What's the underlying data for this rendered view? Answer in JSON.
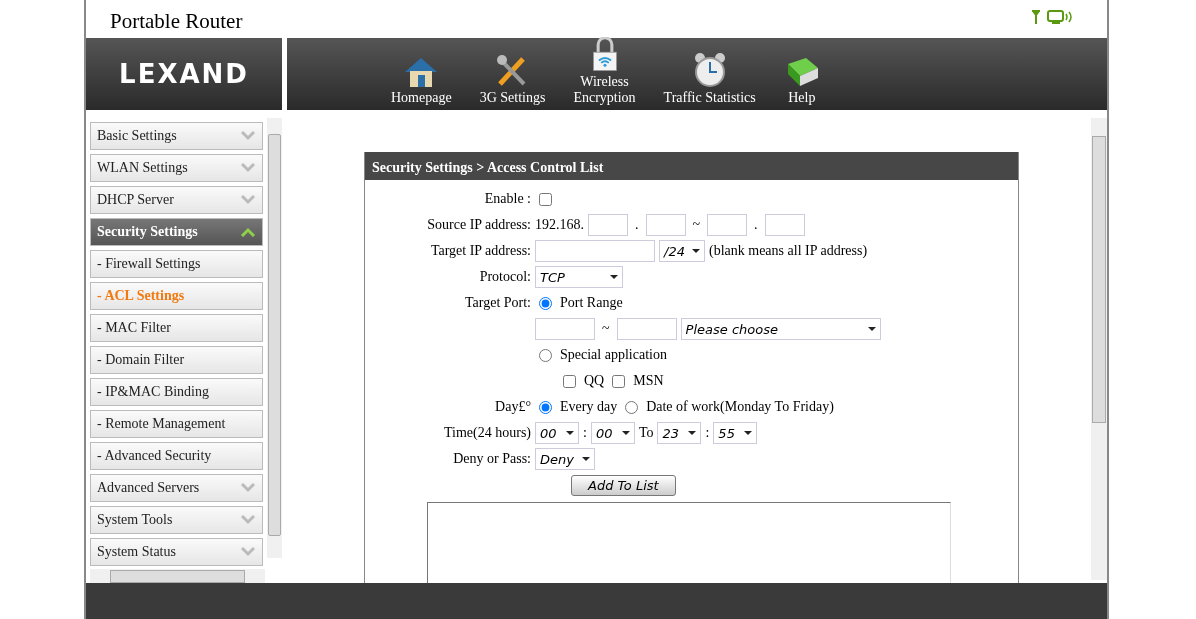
{
  "window": {
    "title": "Portable Router"
  },
  "logo": {
    "text": "LEXAND"
  },
  "nav": [
    {
      "label": "Homepage"
    },
    {
      "label": "3G Settings"
    },
    {
      "label": "Wireless\nEncryption"
    },
    {
      "label": "Traffic Statistics"
    },
    {
      "label": "Help"
    }
  ],
  "sidebar": {
    "items": [
      {
        "label": "Basic Settings",
        "kind": "group",
        "expanded": false,
        "selected": false
      },
      {
        "label": "WLAN Settings",
        "kind": "group",
        "expanded": false,
        "selected": false
      },
      {
        "label": "DHCP Server",
        "kind": "group",
        "expanded": false,
        "selected": false
      },
      {
        "label": "Security Settings",
        "kind": "group",
        "expanded": true,
        "selected": false
      },
      {
        "label": "- Firewall Settings",
        "kind": "sub",
        "selected": false
      },
      {
        "label": "- ACL Settings",
        "kind": "sub",
        "selected": true
      },
      {
        "label": "- MAC Filter",
        "kind": "sub",
        "selected": false
      },
      {
        "label": "- Domain Filter",
        "kind": "sub",
        "selected": false
      },
      {
        "label": "- IP&MAC Binding",
        "kind": "sub",
        "selected": false
      },
      {
        "label": "- Remote Management",
        "kind": "sub",
        "selected": false
      },
      {
        "label": "- Advanced Security",
        "kind": "sub",
        "selected": false
      },
      {
        "label": "Advanced Servers",
        "kind": "group",
        "expanded": false,
        "selected": false
      },
      {
        "label": "System Tools",
        "kind": "group",
        "expanded": false,
        "selected": false
      },
      {
        "label": "System Status",
        "kind": "group",
        "expanded": false,
        "selected": false
      }
    ]
  },
  "panel": {
    "title": "Security Settings > Access Control List",
    "enable": {
      "label": "Enable :",
      "checked": false
    },
    "source_ip": {
      "label": "Source IP address:",
      "prefix": "192.168.",
      "dot": ".",
      "tilde": "~"
    },
    "target_ip": {
      "label": "Target IP address:",
      "mask": "/24",
      "hint": "(blank means all IP address)"
    },
    "protocol": {
      "label": "Protocol:",
      "value": "TCP"
    },
    "target_port": {
      "label": "Target Port:",
      "options": [
        {
          "label": "Port Range",
          "selected": true
        },
        {
          "label": "Special application",
          "selected": false
        }
      ],
      "tilde": "~",
      "service": "Please choose",
      "apps": [
        {
          "label": "QQ",
          "checked": false
        },
        {
          "label": "MSN",
          "checked": false
        }
      ]
    },
    "day": {
      "label": "Day£°",
      "options": [
        {
          "label": "Every day",
          "selected": true
        },
        {
          "label": "Date of work(Monday To Friday)",
          "selected": false
        }
      ]
    },
    "time": {
      "label": "Time(24 hours)",
      "from_h": "00",
      "from_m": "00",
      "to": "To",
      "to_h": "23",
      "to_m": "55",
      "colon": ":"
    },
    "action": {
      "label": "Deny or Pass:",
      "value": "Deny"
    },
    "add_button": "Add To List"
  }
}
